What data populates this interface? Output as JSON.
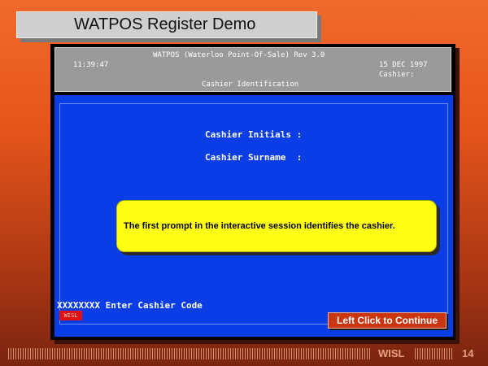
{
  "slide": {
    "title": "WATPOS Register Demo",
    "footer_brand": "WISL",
    "page_number": "14"
  },
  "header": {
    "app_title": "WATPOS (Waterloo Point-Of-Sale) Rev 3.0",
    "time": "11:39:47",
    "date": "15 DEC 1997",
    "cashier_label": "Cashier:",
    "screen_title": "Cashier Identification"
  },
  "form": {
    "initials_label": "Cashier Initials :",
    "surname_label": "Cashier Surname  :"
  },
  "callout": {
    "text": "The first prompt in the interactive session identifies the cashier."
  },
  "status": {
    "prompt": "XXXXXXXX Enter Cashier Code",
    "badge": "WISL"
  },
  "buttons": {
    "continue_label": "Left Click to Continue"
  },
  "colors": {
    "background_top": "#f06a2a",
    "screen_blue": "#0a3de6",
    "header_gray": "#9a9a9a",
    "callout_yellow": "#ffff14",
    "button_red": "#c9360f"
  }
}
